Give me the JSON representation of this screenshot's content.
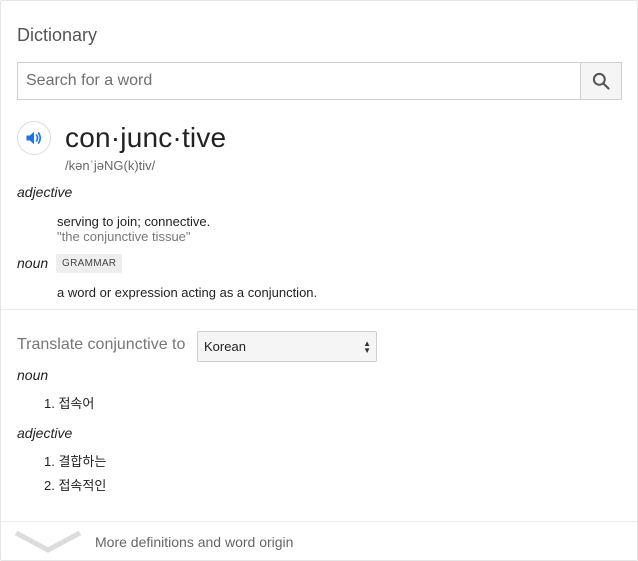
{
  "header": {
    "title": "Dictionary"
  },
  "search": {
    "placeholder": "Search for a word",
    "value": "",
    "button_icon": "search-icon"
  },
  "entry": {
    "headword": "con·junc·tive",
    "phonetic": "/kənˈjəNG(k)tiv/",
    "audio_icon": "speaker-icon",
    "senses": [
      {
        "pos": "adjective",
        "definition": "serving to join; connective.",
        "example": "\"the conjunctive tissue\""
      },
      {
        "pos": "noun",
        "label": "GRAMMAR",
        "definition": "a word or expression acting as a conjunction."
      }
    ]
  },
  "translate": {
    "label": "Translate conjunctive to",
    "language": "Korean",
    "groups": [
      {
        "pos": "noun",
        "items": [
          "1. 접속어"
        ]
      },
      {
        "pos": "adjective",
        "items": [
          "1. 결합하는",
          "2. 접속적인"
        ]
      }
    ]
  },
  "footer": {
    "more_label": "More definitions and word origin",
    "icon": "chevron-down-icon"
  },
  "colors": {
    "accent": "#1a73e8",
    "muted": "#777777",
    "border": "#d0d0d0"
  }
}
